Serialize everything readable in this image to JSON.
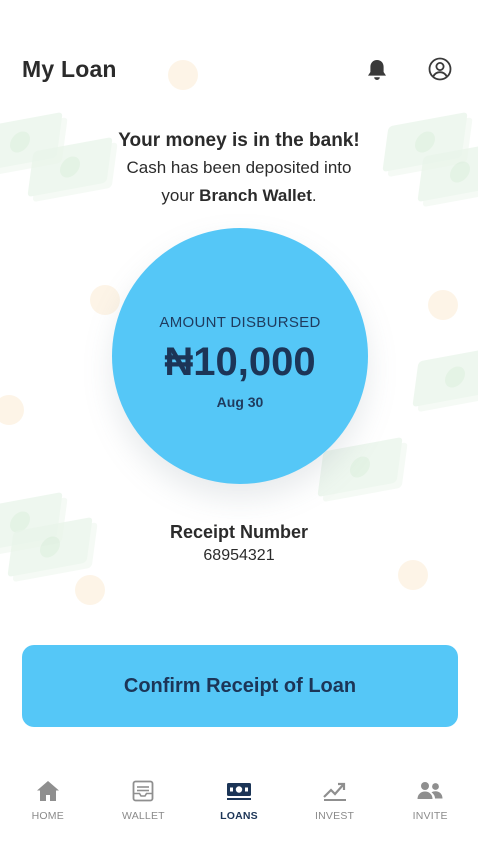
{
  "header": {
    "title": "My Loan",
    "icons": [
      "bell-icon",
      "profile-icon"
    ]
  },
  "message": {
    "title": "Your money is in the bank!",
    "line1": "Cash has been deposited into",
    "line2_prefix": "your",
    "line2_bold": "Branch Wallet",
    "line2_suffix": "."
  },
  "disbursement": {
    "label": "AMOUNT DISBURSED",
    "amount": "₦10,000",
    "date": "Aug 30"
  },
  "receipt": {
    "label": "Receipt Number",
    "number": "68954321"
  },
  "cta": {
    "label": "Confirm Receipt of Loan"
  },
  "nav": {
    "items": [
      {
        "label": "HOME",
        "icon": "home-icon",
        "active": false
      },
      {
        "label": "WALLET",
        "icon": "wallet-icon",
        "active": false
      },
      {
        "label": "LOANS",
        "icon": "loans-icon",
        "active": true
      },
      {
        "label": "INVEST",
        "icon": "invest-icon",
        "active": false
      },
      {
        "label": "INVITE",
        "icon": "invite-icon",
        "active": false
      }
    ]
  },
  "colors": {
    "accent": "#55c7f7",
    "text_dark": "#1c3557",
    "text_body": "#2b2b2b",
    "nav_inactive": "#8a8a8a"
  }
}
